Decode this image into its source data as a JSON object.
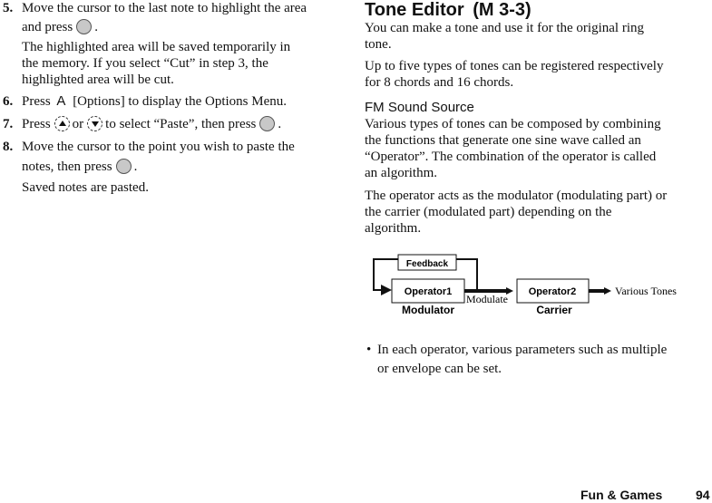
{
  "left_column": {
    "steps": [
      {
        "number": "5.",
        "line1": "Move the cursor to the last note to highlight the area",
        "line2_before": "and press",
        "line2_after": ".",
        "note_lines": [
          "The highlighted area will be saved temporarily in",
          "the memory. If you select “Cut” in step 3, the",
          "highlighted area will be cut."
        ]
      },
      {
        "number": "6.",
        "text_before": "Press",
        "key_label": "A",
        "text_after": "[Options] to display the Options Menu."
      },
      {
        "number": "7.",
        "text_before": "Press",
        "or_text": "or",
        "text_middle": "to select “Paste”, then press",
        "text_after": "."
      },
      {
        "number": "8.",
        "line1": "Move the cursor to the point you wish to paste the",
        "line2_before": "notes, then press",
        "line2_after": ".",
        "note": "Saved notes are pasted."
      }
    ]
  },
  "right_column": {
    "title": "Tone Editor",
    "title_ref": "(M 3-3)",
    "intro_lines": [
      "You can make a tone and use it for the original ring",
      "tone."
    ],
    "para2_lines": [
      "Up to five types of tones can be registered respectively",
      "for 8 chords and 16 chords."
    ],
    "subheading": "FM Sound Source",
    "para3_lines": [
      "Various types of tones can be composed by combining",
      "the functions that generate one sine wave called an",
      "“Operator”. The combination of the operator is called",
      "an algorithm."
    ],
    "para4_lines": [
      "The operator acts as the modulator (modulating part) or",
      "the carrier (modulated part) depending on the",
      "algorithm."
    ],
    "diagram": {
      "feedback_label": "Feedback",
      "operator1_label": "Operator1",
      "operator2_label": "Operator2",
      "modulate_label": "Modulate",
      "modulator_label": "Modulator",
      "carrier_label": "Carrier",
      "output_label": "Various Tones"
    },
    "bullet": "•",
    "bullet_lines": [
      "In each operator, various parameters such as multiple",
      "or envelope can be set."
    ]
  },
  "footer": {
    "section": "Fun & Games",
    "page_number": "94"
  }
}
